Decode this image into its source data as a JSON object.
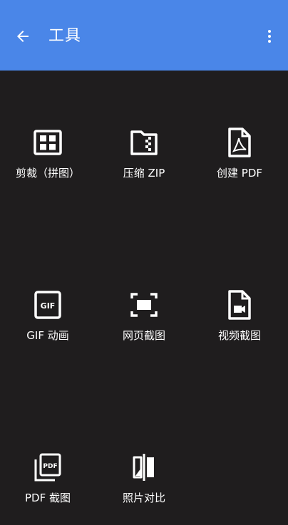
{
  "app_bar": {
    "title": "工具",
    "back_icon": "arrow-back-icon",
    "more_icon": "more-vert-icon",
    "background": "#4a86e8"
  },
  "tools": [
    {
      "label": "剪裁（拼图）",
      "icon": "grid-crop-icon"
    },
    {
      "label": "压缩 ZIP",
      "icon": "zip-folder-icon"
    },
    {
      "label": "创建 PDF",
      "icon": "pdf-file-icon"
    },
    {
      "label": "GIF 动画",
      "icon": "gif-icon"
    },
    {
      "label": "网页截图",
      "icon": "webpage-screenshot-icon"
    },
    {
      "label": "视频截图",
      "icon": "video-file-icon"
    },
    {
      "label": "PDF 截图",
      "icon": "pdf-stack-icon"
    },
    {
      "label": "照片对比",
      "icon": "photo-compare-icon"
    }
  ],
  "colors": {
    "background": "#1f1d1e",
    "icon": "#ffffff"
  }
}
